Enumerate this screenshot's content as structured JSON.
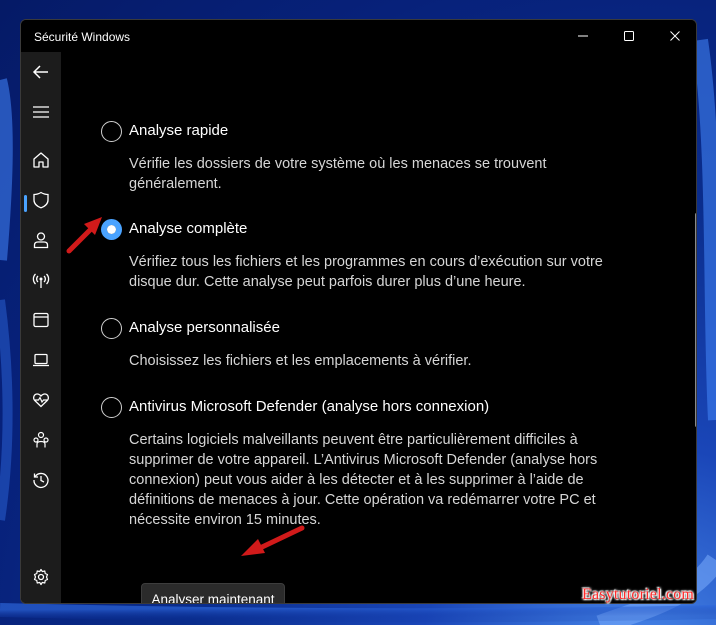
{
  "window": {
    "title": "Sécurité Windows"
  },
  "sidebar": {
    "items": [
      {
        "icon": "back-arrow-icon"
      },
      {
        "icon": "menu-icon"
      },
      {
        "icon": "home-icon"
      },
      {
        "icon": "shield-icon",
        "active": true
      },
      {
        "icon": "account-icon"
      },
      {
        "icon": "network-icon"
      },
      {
        "icon": "app-browser-icon"
      },
      {
        "icon": "device-security-icon"
      },
      {
        "icon": "health-icon"
      },
      {
        "icon": "family-icon"
      },
      {
        "icon": "history-icon"
      },
      {
        "icon": "settings-icon"
      }
    ]
  },
  "scan_options": [
    {
      "label": "Analyse rapide",
      "description": "Vérifie les dossiers de votre système où les menaces se trouvent généralement.",
      "selected": false
    },
    {
      "label": "Analyse complète",
      "description": "Vérifiez tous les fichiers et les programmes en cours d’exécution sur votre disque dur. Cette analyse peut parfois durer plus d’une heure.",
      "selected": true
    },
    {
      "label": "Analyse personnalisée",
      "description": "Choisissez les fichiers et les emplacements à vérifier.",
      "selected": false
    },
    {
      "label": "Antivirus Microsoft Defender (analyse hors connexion)",
      "description": "Certains logiciels malveillants peuvent être particulièrement difficiles à supprimer de votre appareil. L’Antivirus Microsoft Defender (analyse hors connexion) peut vous aider à les détecter et à les supprimer à l’aide de définitions de menaces à jour. Cette opération va redémarrer votre PC et nécessite environ 15 minutes.",
      "selected": false
    }
  ],
  "actions": {
    "scan_now_label": "Analyser maintenant"
  },
  "watermark": "Easytutoriel.com",
  "colors": {
    "accent": "#4aa3ff",
    "annotation_arrow": "#d11a1a"
  }
}
